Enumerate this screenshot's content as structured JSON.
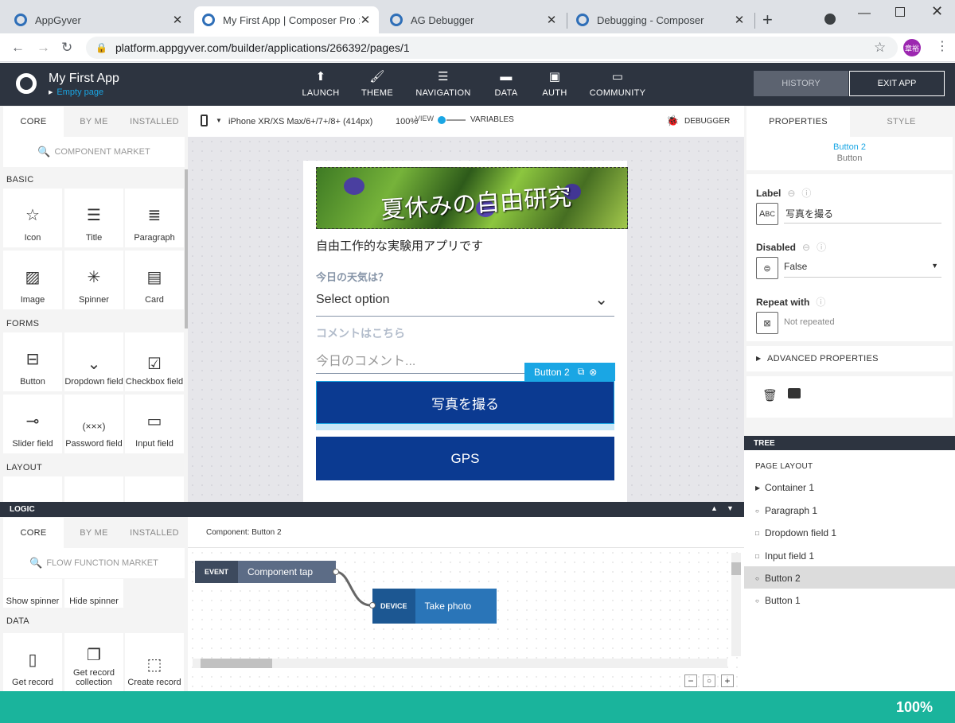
{
  "browser": {
    "tabs": [
      {
        "title": "AppGyver"
      },
      {
        "title": "My First App | Composer Pro : pl"
      },
      {
        "title": "AG Debugger"
      },
      {
        "title": "Debugging - Composer"
      }
    ],
    "url": "platform.appgyver.com/builder/applications/266392/pages/1",
    "profile_initials": "章裕"
  },
  "header": {
    "app_name": "My First App",
    "page_name": "Empty page",
    "nav": [
      {
        "label": "LAUNCH",
        "icon": "launch-icon"
      },
      {
        "label": "THEME",
        "icon": "theme-icon"
      },
      {
        "label": "NAVIGATION",
        "icon": "navigation-icon"
      },
      {
        "label": "DATA",
        "icon": "data-icon"
      },
      {
        "label": "AUTH",
        "icon": "auth-icon"
      },
      {
        "label": "COMMUNITY",
        "icon": "community-icon"
      }
    ],
    "history_label": "HISTORY",
    "exit_label": "EXIT APP"
  },
  "left_panel": {
    "tabs": [
      "CORE",
      "BY ME",
      "INSTALLED"
    ],
    "search_placeholder": "COMPONENT MARKET",
    "sections": {
      "basic": "BASIC",
      "forms": "FORMS",
      "layout": "LAYOUT"
    },
    "basic_items": [
      "Icon",
      "Title",
      "Paragraph",
      "Image",
      "Spinner",
      "Card"
    ],
    "form_items": [
      "Button",
      "Dropdown field",
      "Checkbox field",
      "Slider field",
      "Password field",
      "Input field"
    ]
  },
  "toolbar": {
    "device": "iPhone XR/XS Max/6+/7+/8+ (414px)",
    "zoom": "100%",
    "view_label": "VIEW",
    "variables_label": "VARIABLES",
    "debugger_label": "DEBUGGER"
  },
  "phone": {
    "banner_text": "夏休みの自由研究",
    "paragraph": "自由工作的な実験用アプリです",
    "weather_label": "今日の天気は？",
    "select_value": "Select option",
    "comment_label": "コメントはこちら",
    "comment_placeholder": "今日のコメント...",
    "selected_tag": "Button 2",
    "button2_label": "写真を撮る",
    "button1_label": "GPS"
  },
  "properties": {
    "tabs": [
      "PROPERTIES",
      "STYLE"
    ],
    "component_name": "Button 2",
    "component_type": "Button",
    "label_title": "Label",
    "label_value": "写真を撮る",
    "disabled_title": "Disabled",
    "disabled_value": "False",
    "repeat_title": "Repeat with",
    "repeat_value": "Not repeated",
    "advanced": "ADVANCED PROPERTIES"
  },
  "tree": {
    "title": "TREE",
    "layout_label": "PAGE LAYOUT",
    "items": [
      {
        "label": "Container 1",
        "marker": "triangle"
      },
      {
        "label": "Paragraph 1",
        "marker": "circle"
      },
      {
        "label": "Dropdown field 1",
        "marker": "square"
      },
      {
        "label": "Input field 1",
        "marker": "square"
      },
      {
        "label": "Button 2",
        "marker": "circle",
        "selected": true
      },
      {
        "label": "Button 1",
        "marker": "circle"
      }
    ]
  },
  "logic": {
    "title": "LOGIC",
    "tabs": [
      "CORE",
      "BY ME",
      "INSTALLED"
    ],
    "search_placeholder": "FLOW FUNCTION MARKET",
    "top_items": [
      "Show spinner",
      "Hide spinner"
    ],
    "data_section": "DATA",
    "data_items": [
      "Get record",
      "Get record collection",
      "Create record"
    ],
    "component_label": "Component: Button 2",
    "event_tag": "EVENT",
    "event_label": "Component tap",
    "device_tag": "DEVICE",
    "device_label": "Take photo"
  },
  "status": {
    "zoom": "100%"
  },
  "colors": {
    "header_bg": "#2d3440",
    "accent": "#1aa6e4",
    "button": "#0b3a91",
    "status_bar": "#1ab49c"
  }
}
